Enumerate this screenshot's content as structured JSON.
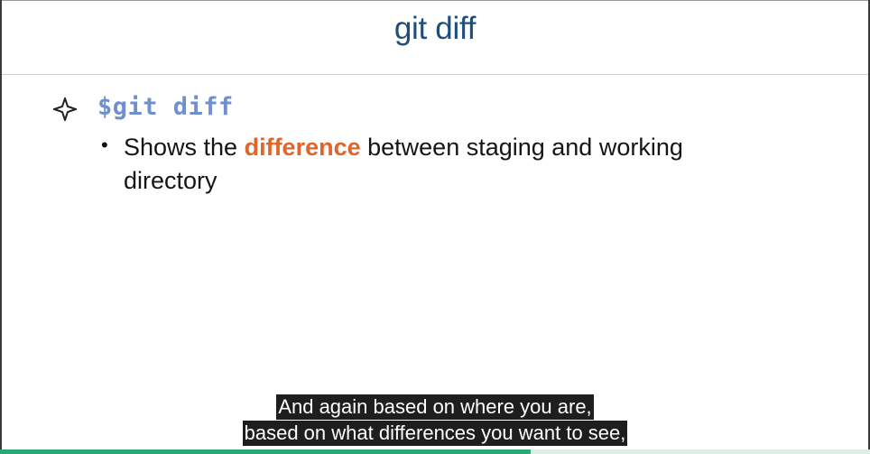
{
  "slide": {
    "title": "git diff",
    "bullet_icon": "four-point-star-icon",
    "command": "$git diff",
    "sub_bullet": {
      "prefix": "Shows the ",
      "highlight": "difference",
      "suffix": " between staging and working directory"
    }
  },
  "captions": {
    "line1": "And again based on where you are,",
    "line2": "based on what differences you want to see,"
  },
  "player": {
    "progress_fraction": 0.61
  },
  "colors": {
    "title": "#1f4e79",
    "command": "#6f8fd0",
    "highlight": "#e0652b",
    "progress": "#2aa876"
  }
}
